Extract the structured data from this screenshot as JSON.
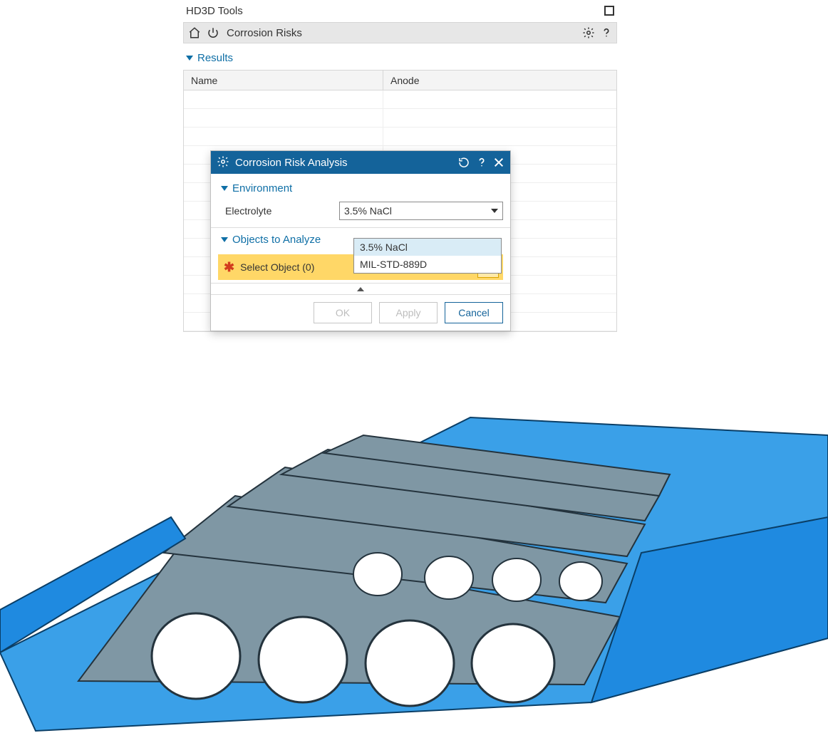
{
  "panel": {
    "title": "HD3D Tools",
    "crumb": "Corrosion Risks",
    "results_label": "Results",
    "cols": {
      "name": "Name",
      "anode": "Anode"
    }
  },
  "dialog": {
    "title": "Corrosion Risk Analysis",
    "env_label": "Environment",
    "electrolyte_label": "Electrolyte",
    "electrolyte_value": "3.5% NaCl",
    "options": [
      "3.5% NaCl",
      "MIL-STD-889D"
    ],
    "objects_label": "Objects to Analyze",
    "select_object": "Select Object (0)",
    "ok": "OK",
    "apply": "Apply",
    "cancel": "Cancel"
  }
}
